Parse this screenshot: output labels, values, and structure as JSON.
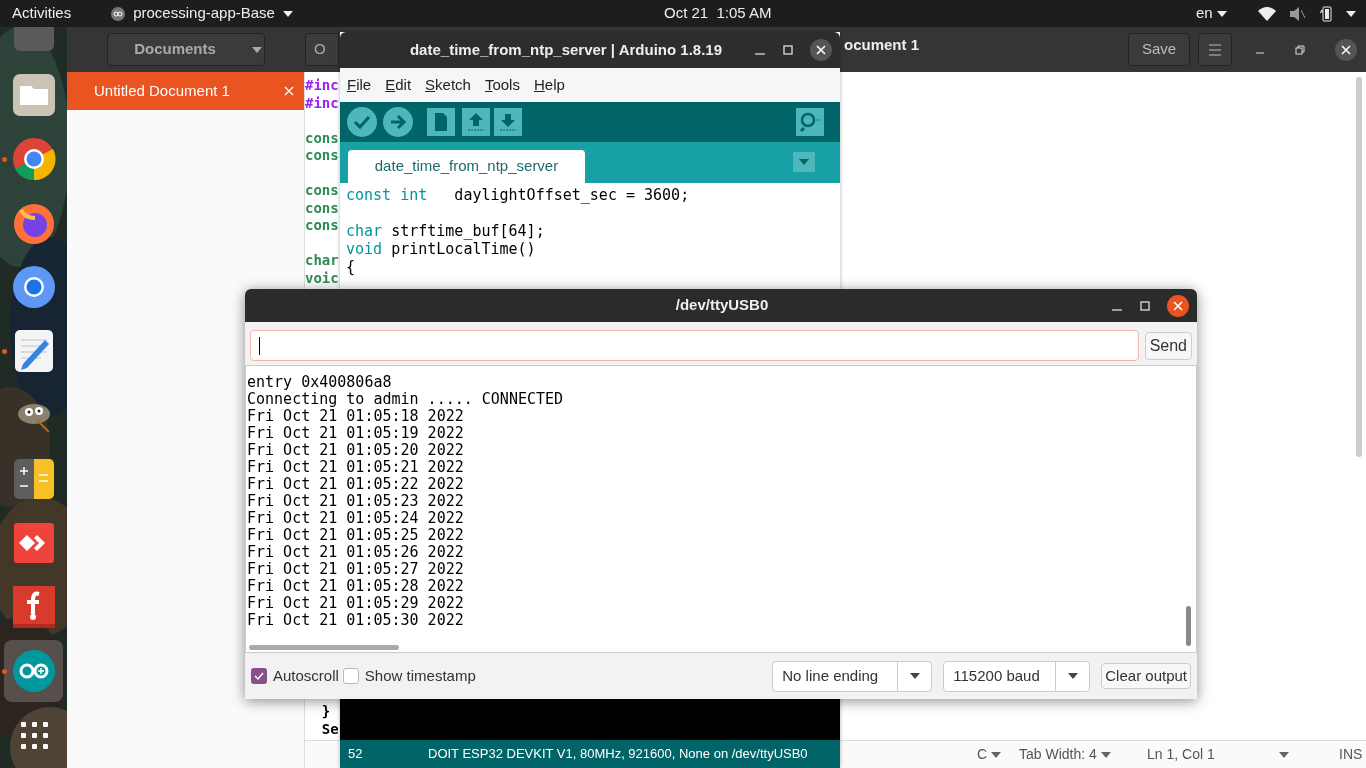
{
  "top_bar": {
    "activities": "Activities",
    "app_menu": "processing-app-Base",
    "clock": "Oct 21  1:05 AM",
    "language": "en"
  },
  "dock": {
    "items": [
      {
        "kind": "app",
        "running": false,
        "selected": false
      },
      {
        "kind": "files",
        "running": false,
        "selected": false
      },
      {
        "kind": "chrome",
        "running": true,
        "selected": false
      },
      {
        "kind": "firefox",
        "running": false,
        "selected": false
      },
      {
        "kind": "chromium",
        "running": false,
        "selected": false
      },
      {
        "kind": "text_editor",
        "running": true,
        "selected": false
      },
      {
        "kind": "gimp",
        "running": false,
        "selected": false
      },
      {
        "kind": "calculator",
        "running": false,
        "selected": false
      },
      {
        "kind": "anydesk",
        "running": false,
        "selected": false
      },
      {
        "kind": "fritzing",
        "running": false,
        "selected": false
      },
      {
        "kind": "arduino",
        "running": true,
        "selected": true
      },
      {
        "kind": "app_grid",
        "running": false,
        "selected": false
      }
    ]
  },
  "gedit": {
    "documents_button": "Documents",
    "open_button": "O",
    "title": "ocument 1",
    "save_button": "Save",
    "documents": [
      {
        "name": "Untitled Document 1",
        "selected": true
      }
    ],
    "code_top": [
      [
        {
          "text": "#inc",
          "color": "#a020f0"
        },
        {
          "text": "#inc",
          "color": "#a020f0"
        }
      ],
      [
        {
          "text": "cons",
          "color": "#2e8b57"
        },
        {
          "text": "cons",
          "color": "#2e8b57"
        }
      ],
      [
        {
          "text": "cons",
          "color": "#2e8b57"
        },
        {
          "text": "cons",
          "color": "#2e8b57"
        },
        {
          "text": "cons",
          "color": "#2e8b57"
        }
      ],
      [
        {
          "text": "char",
          "color": "#2e8b57"
        },
        {
          "text": "voic",
          "color": "#2e8b57"
        }
      ]
    ],
    "code_bottom": [
      [
        {
          "text": "  }",
          "color": "#000000"
        },
        {
          "text": "  Se",
          "color": "#000000"
        }
      ]
    ],
    "status": {
      "language": "C",
      "tab_width": "Tab Width: 4",
      "position": "Ln 1, Col 1",
      "mode": "INS"
    }
  },
  "arduino": {
    "title": "date_time_from_ntp_server | Arduino 1.8.19",
    "menus": [
      "File",
      "Edit",
      "Sketch",
      "Tools",
      "Help"
    ],
    "toolbar": [
      {
        "kind": "verify"
      },
      {
        "kind": "upload"
      },
      {
        "kind": "new"
      },
      {
        "kind": "open"
      },
      {
        "kind": "save"
      }
    ],
    "tab": "date_time_from_ntp_server",
    "code": [
      [
        {
          "tokens": [
            {
              "text": "const int",
              "kind": "keyword"
            },
            {
              "text": "   daylightOffset_sec = 3600;",
              "kind": "plain"
            }
          ]
        }
      ],
      [
        {
          "tokens": [
            {
              "text": "char",
              "kind": "keyword"
            },
            {
              "text": " strftime_buf[64];",
              "kind": "plain"
            }
          ]
        },
        {
          "tokens": [
            {
              "text": "void",
              "kind": "keyword"
            },
            {
              "text": " printLocalTime()",
              "kind": "plain"
            }
          ]
        },
        {
          "tokens": [
            {
              "text": "{",
              "kind": "plain"
            }
          ]
        }
      ]
    ],
    "status": {
      "line": "52",
      "board": "DOIT ESP32 DEVKIT V1, 80MHz, 921600, None on /dev/ttyUSB0"
    }
  },
  "serial": {
    "title": "/dev/ttyUSB0",
    "send_button": "Send",
    "output": [
      "entry 0x400806a8",
      "Connecting to admin ..... CONNECTED",
      "Fri Oct 21 01:05:18 2022",
      "Fri Oct 21 01:05:19 2022",
      "Fri Oct 21 01:05:20 2022",
      "Fri Oct 21 01:05:21 2022",
      "Fri Oct 21 01:05:22 2022",
      "Fri Oct 21 01:05:23 2022",
      "Fri Oct 21 01:05:24 2022",
      "Fri Oct 21 01:05:25 2022",
      "Fri Oct 21 01:05:26 2022",
      "Fri Oct 21 01:05:27 2022",
      "Fri Oct 21 01:05:28 2022",
      "Fri Oct 21 01:05:29 2022",
      "Fri Oct 21 01:05:30 2022"
    ],
    "autoscroll": {
      "label": "Autoscroll",
      "checked": true
    },
    "timestamp": {
      "label": "Show timestamp",
      "checked": false
    },
    "line_ending": "No line ending",
    "baud": "115200 baud",
    "clear_button": "Clear output"
  }
}
